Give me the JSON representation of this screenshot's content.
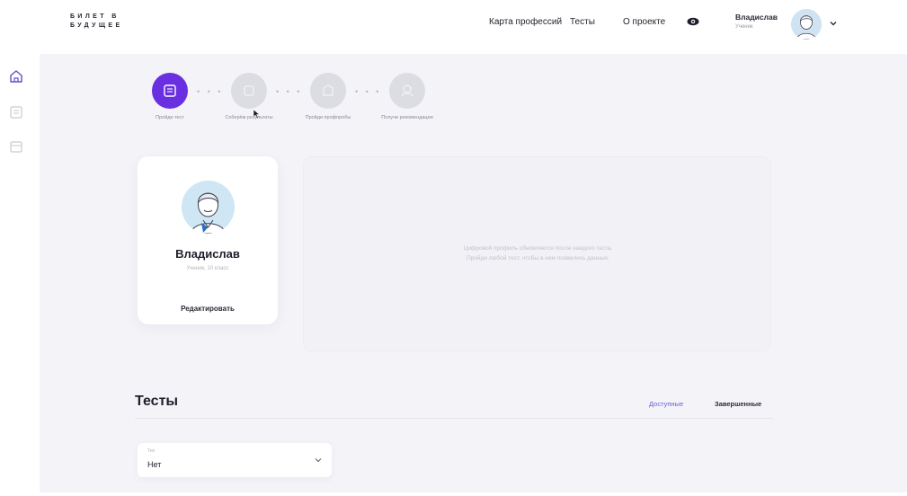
{
  "brand": {
    "logo_line1": "БИЛЕТ В",
    "logo_line2": "БУДУЩЕЕ"
  },
  "nav": {
    "karta": "Карта профессий",
    "tests": "Тесты",
    "about": "О проекте"
  },
  "user": {
    "name": "Владислав",
    "role": "Ученик"
  },
  "stepper": [
    {
      "label": "Пройди тест",
      "active": true,
      "icon": "test-icon"
    },
    {
      "label": "Соберём результаты",
      "active": false,
      "icon": "results-icon"
    },
    {
      "label": "Пройди профпробы",
      "active": false,
      "icon": "trials-icon"
    },
    {
      "label": "Получи рекомендации",
      "active": false,
      "icon": "recommendations-icon"
    }
  ],
  "profile": {
    "name": "Владислав",
    "subtitle": "Ученик, 10 класс",
    "edit_label": "Редактировать"
  },
  "empty_panel": {
    "line1": "Цифровой профиль обновляется после каждого теста.",
    "line2": "Пройди любой тест, чтобы в нем появились данные."
  },
  "tests": {
    "title": "Тесты",
    "tab_available": "Доступные",
    "tab_done": "Завершенные",
    "filter_label": "Тип",
    "filter_value": "Нет"
  },
  "colors": {
    "accent": "#6a2fe0",
    "link": "#6a5fd8",
    "background": "#f3f3f8"
  }
}
